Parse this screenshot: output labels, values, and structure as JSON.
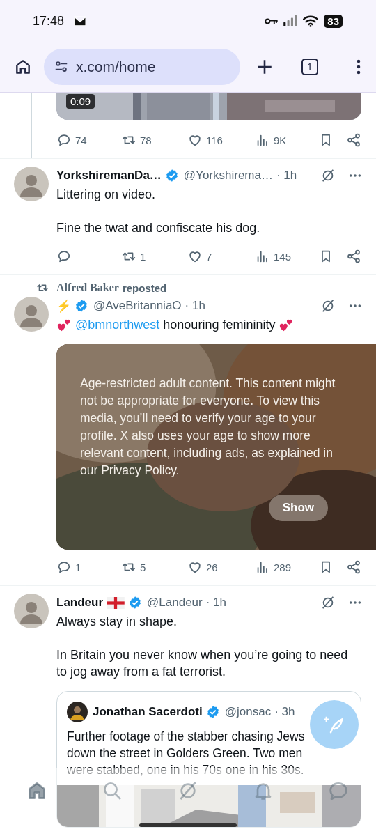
{
  "status_bar": {
    "time": "17:48",
    "battery": "83"
  },
  "browser": {
    "url": "x.com/home",
    "tab_count": "1"
  },
  "tweets": [
    {
      "kind": "media-tail",
      "duration": "0:09",
      "stats": {
        "replies": "74",
        "reposts": "78",
        "likes": "116",
        "views": "9K"
      }
    },
    {
      "kind": "post",
      "name": "YorkshiremanDa…",
      "verified": true,
      "handle": "@Yorkshirema…",
      "time": "· 1h",
      "text": "Littering on video.\n\nFine the twat and confiscate his dog.",
      "stats": {
        "reposts": "1",
        "likes": "7",
        "views": "145"
      }
    },
    {
      "kind": "post",
      "reposted_by": "Alfred Baker",
      "repost_label": "reposted",
      "name": "⚡",
      "verified": true,
      "handle": "@AveBritanniaO",
      "time": "· 1h",
      "hearts": true,
      "mention": "@bmnorthwest",
      "text": "honouring femininity",
      "sensitive": {
        "message": "Age-restricted adult content. This content might not be appropriate for everyone. To view this media, you’ll need to verify your age to your profile. X also uses your age to show more relevant content, including ads, as explained in our Privacy Policy.",
        "button": "Show"
      },
      "stats": {
        "replies": "1",
        "reposts": "5",
        "likes": "26",
        "views": "289"
      }
    },
    {
      "kind": "post",
      "name": "Landeur",
      "flag": true,
      "verified": true,
      "handle": "@Landeur",
      "time": "· 1h",
      "text": "Always stay in shape.\n\nIn Britain you never know when you’re going to need to jog away from a fat terrorist.",
      "quote": {
        "name": "Jonathan Sacerdoti",
        "verified": true,
        "handle": "@jonsac",
        "time": "· 3h",
        "text": "Further footage of the stabber chasing Jews down the street in Golders Green. Two men were stabbed, one in his 70s one in his 30s."
      }
    }
  ],
  "nav": [
    {
      "selected": true
    },
    {
      "selected": false
    },
    {
      "selected": false
    },
    {
      "selected": false
    },
    {
      "selected": false
    }
  ]
}
